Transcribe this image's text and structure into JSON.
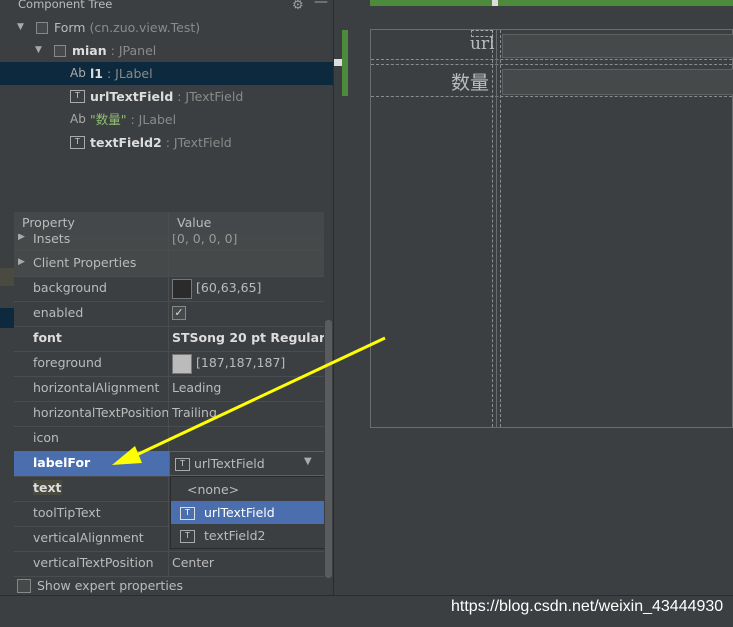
{
  "component_tree": {
    "title": "Component Tree",
    "nodes": [
      {
        "name": "Form",
        "type": "(cn.zuo.view.Test)"
      },
      {
        "name": "mian",
        "type": ": JPanel"
      },
      {
        "icon": "Ab",
        "name": "l1",
        "type": ": JLabel"
      },
      {
        "name": "urlTextField",
        "type": ": JTextField"
      },
      {
        "icon": "Ab",
        "name": "\"数量\"",
        "type": ": JLabel"
      },
      {
        "name": "textField2",
        "type": ": JTextField"
      }
    ]
  },
  "properties": {
    "header": {
      "property": "Property",
      "value": "Value"
    },
    "rows": [
      {
        "name": "Insets",
        "value": "[0, 0, 0, 0]"
      },
      {
        "name": "Client Properties",
        "value": ""
      },
      {
        "name": "background",
        "value": "[60,63,65]",
        "swatch": "#2b2b2b"
      },
      {
        "name": "enabled",
        "value": "✓"
      },
      {
        "name": "font",
        "value": "STSong 20 pt Regular"
      },
      {
        "name": "foreground",
        "value": "[187,187,187]",
        "swatch": "#bbbbbb"
      },
      {
        "name": "horizontalAlignment",
        "value": "Leading"
      },
      {
        "name": "horizontalTextPosition",
        "value": "Trailing"
      },
      {
        "name": "icon",
        "value": ""
      },
      {
        "name": "labelFor",
        "value": "urlTextField"
      },
      {
        "name": "text",
        "value": ""
      },
      {
        "name": "toolTipText",
        "value": ""
      },
      {
        "name": "verticalAlignment",
        "value": ""
      },
      {
        "name": "verticalTextPosition",
        "value": "Center"
      }
    ],
    "dropdown_options": [
      "<none>",
      "urlTextField",
      "textField2"
    ]
  },
  "expert": {
    "label": "Show expert properties"
  },
  "designer": {
    "label_url": "url",
    "label_quantity": "数量"
  },
  "watermark": "https://blog.csdn.net/weixin_43444930",
  "colors": {
    "selection": "#4b6eaf",
    "tree_selection": "#0d293e",
    "green_guide": "#4e8a3c",
    "arrow": "#ffff00"
  }
}
